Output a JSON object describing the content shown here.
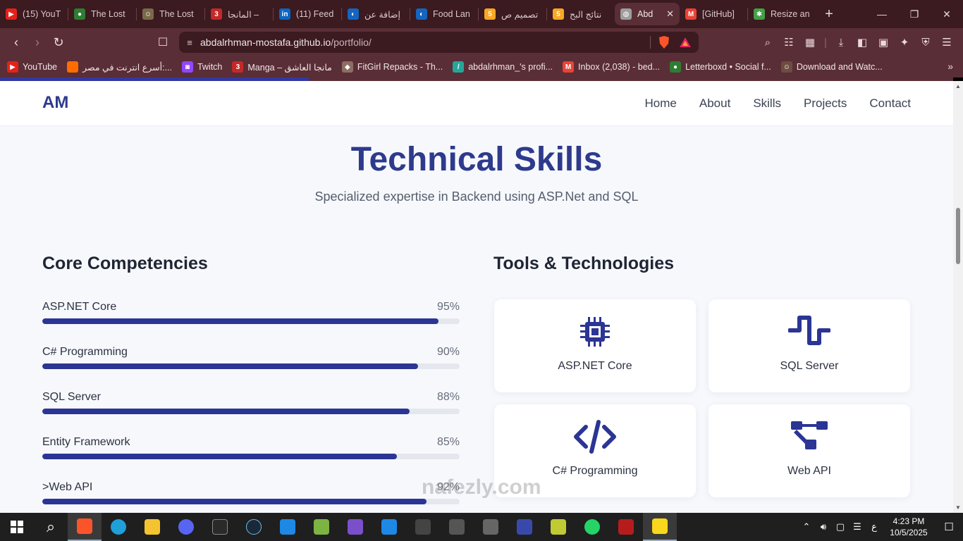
{
  "browser": {
    "tabs": [
      {
        "title": "(15) YouT",
        "fav_color": "#e62117",
        "fav_glyph": "▶"
      },
      {
        "title": "The Lost",
        "fav_color": "#2e7d32",
        "fav_glyph": "●"
      },
      {
        "title": "The Lost",
        "fav_color": "#7a6a4a",
        "fav_glyph": "☺"
      },
      {
        "title": "المانجا –",
        "fav_color": "#c62828",
        "fav_glyph": "3"
      },
      {
        "title": "(11) Feed",
        "fav_color": "#0a66c2",
        "fav_glyph": "in"
      },
      {
        "title": "إضافة عن",
        "fav_color": "#1565c0",
        "fav_glyph": "◐"
      },
      {
        "title": "Food Lan",
        "fav_color": "#1565c0",
        "fav_glyph": "◐"
      },
      {
        "title": "تصميم ص",
        "fav_color": "#f9a825",
        "fav_glyph": "5"
      },
      {
        "title": "نتائج البح",
        "fav_color": "#f9a825",
        "fav_glyph": "5"
      },
      {
        "title": "Abd",
        "fav_color": "#9e9e9e",
        "fav_glyph": "◍",
        "active": true
      },
      {
        "title": "[GitHub]",
        "fav_color": "#ea4335",
        "fav_glyph": "M"
      },
      {
        "title": "Resize an",
        "fav_color": "#43a047",
        "fav_glyph": "✱"
      }
    ],
    "close_tab_glyph": "✕",
    "new_tab_glyph": "+",
    "url_host": "abdalrhman-mostafa.github.io",
    "url_path": "/portfolio/",
    "bookmarks": [
      {
        "label": "YouTube",
        "fav_color": "#e62117",
        "fav_glyph": "▶"
      },
      {
        "label": "أسرع انترنت في مصر:...",
        "fav_color": "#ff6d00",
        "fav_glyph": ""
      },
      {
        "label": "Twitch",
        "fav_color": "#9146ff",
        "fav_glyph": "◙"
      },
      {
        "label": "Manga – مانجا العاشق",
        "fav_color": "#c62828",
        "fav_glyph": "3"
      },
      {
        "label": "FitGirl Repacks - Th...",
        "fav_color": "#8d6e63",
        "fav_glyph": "◆"
      },
      {
        "label": "abdalrhman_'s profi...",
        "fav_color": "#26a69a",
        "fav_glyph": "/"
      },
      {
        "label": "Inbox (2,038) - bed...",
        "fav_color": "#ea4335",
        "fav_glyph": "M"
      },
      {
        "label": "Letterboxd • Social f...",
        "fav_color": "#2e7d32",
        "fav_glyph": "●"
      },
      {
        "label": "Download and Watc...",
        "fav_color": "#6d4c41",
        "fav_glyph": "☺"
      }
    ]
  },
  "site": {
    "logo": "AM",
    "nav": [
      "Home",
      "About",
      "Skills",
      "Projects",
      "Contact"
    ],
    "section_title": "Technical Skills",
    "section_subtitle": "Specialized expertise in Backend using ASP.Net and SQL",
    "core_title": "Core Competencies",
    "tools_title": "Tools & Technologies",
    "skills": [
      {
        "name": "ASP.NET Core",
        "percent_label": "95%",
        "level": 0.95
      },
      {
        "name": "C# Programming",
        "percent_label": "90%",
        "level": 0.9
      },
      {
        "name": "SQL Server",
        "percent_label": "88%",
        "level": 0.88
      },
      {
        "name": "Entity Framework",
        "percent_label": "85%",
        "level": 0.85
      },
      {
        "name": ">Web API",
        "percent_label": "92%",
        "level": 0.92
      }
    ],
    "tools": [
      {
        "label": "ASP.NET Core",
        "icon": "microchip-icon"
      },
      {
        "label": "SQL Server",
        "icon": "wave-square-icon"
      },
      {
        "label": "C# Programming",
        "icon": "code-icon"
      },
      {
        "label": "Web API",
        "icon": "project-diagram-icon"
      }
    ],
    "accent": "#2e3a8c"
  },
  "watermark": "nafezly.com",
  "taskbar": {
    "time": "4:23 PM",
    "date": "10/5/2025",
    "lang": "ع"
  }
}
